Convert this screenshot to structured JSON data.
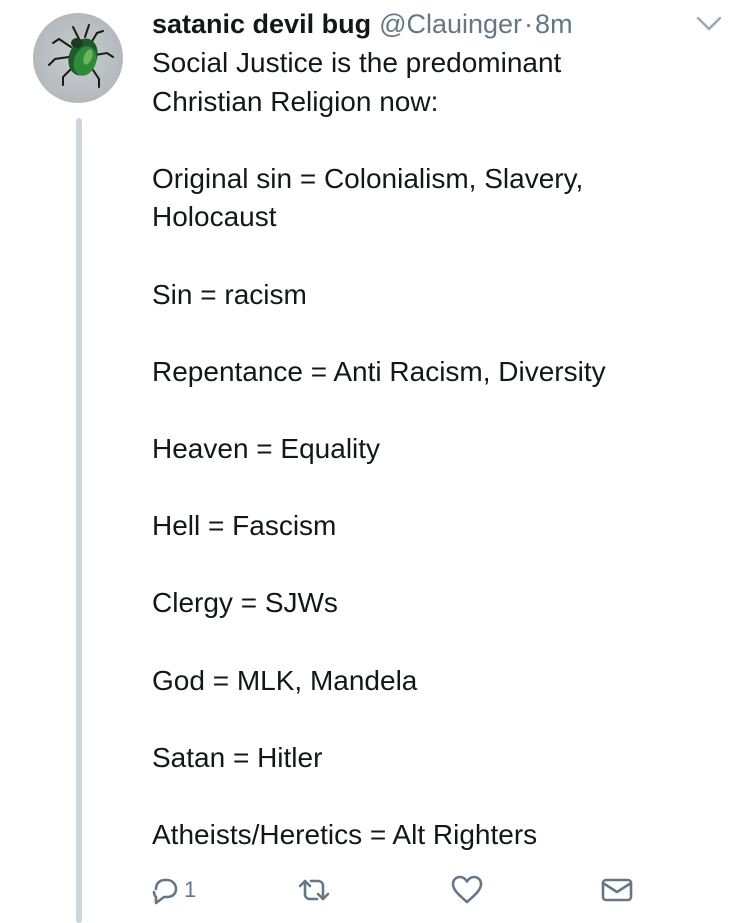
{
  "tweet": {
    "display_name": "satanic devil bug",
    "handle": "@Clauinger",
    "separator": "·",
    "time": "8m",
    "lines": [
      "Social Justice is the predominant",
      "Christian Religion now:",
      "",
      "Original sin = Colonialism, Slavery,",
      "Holocaust",
      "",
      "Sin = racism",
      "",
      "Repentance = Anti Racism, Diversity",
      "",
      "Heaven = Equality",
      "",
      "Hell = Fascism",
      "",
      "Clergy = SJWs",
      "",
      "God = MLK, Mandela",
      "",
      "Satan = Hitler",
      "",
      "Atheists/Heretics = Alt Righters"
    ],
    "reply_count": "1"
  },
  "icons": {
    "avatar": "beetle-avatar",
    "caret": "chevron-down-icon",
    "reply": "reply-icon",
    "retweet": "retweet-icon",
    "like": "heart-icon",
    "dm": "envelope-icon"
  },
  "colors": {
    "text": "#14171a",
    "secondary": "#657786",
    "thread_line": "#ccd6dd"
  }
}
